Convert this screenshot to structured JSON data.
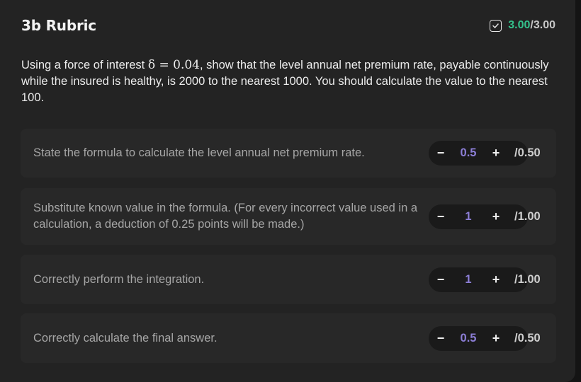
{
  "rubric": {
    "title": "3b Rubric",
    "score_earned": "3.00",
    "score_total": "/3.00",
    "icon": "checkbox-icon"
  },
  "question": {
    "text_before": "Using a force of interest ",
    "math": "δ = 0.04",
    "text_after": ", show that the level annual net premium rate, payable continuously while the insured is healthy, is 2000 to the nearest 1000. You should calculate the value to the nearest 100."
  },
  "criteria": [
    {
      "text": "State the formula to calculate the level annual net premium rate.",
      "value": "0.5",
      "max": "/0.50"
    },
    {
      "text": "Substitute known value in the formula. (For every incorrect value used in a calculation, a deduction of 0.25 points will be made.)",
      "value": "1",
      "max": "/1.00"
    },
    {
      "text": "Correctly perform the integration.",
      "value": "1",
      "max": "/1.00"
    },
    {
      "text": "Correctly calculate the final answer.",
      "value": "0.5",
      "max": "/0.50"
    }
  ],
  "stepper": {
    "minus": "−",
    "plus": "+"
  },
  "colors": {
    "accent_score": "#34c28c",
    "accent_value": "#8c7ed6",
    "panel": "#232323"
  }
}
